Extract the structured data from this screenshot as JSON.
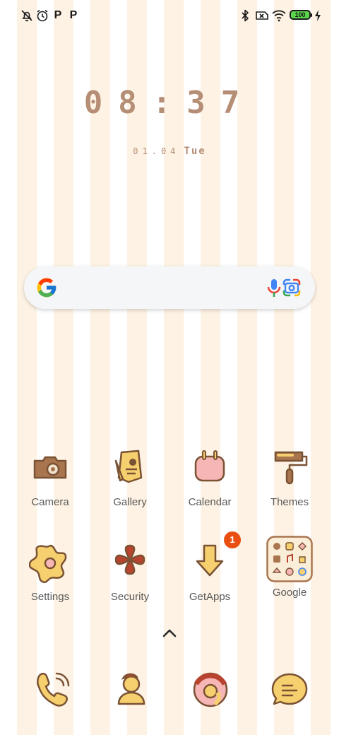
{
  "status_bar": {
    "left_icons": [
      "notifications-off-icon",
      "alarm-icon",
      "p-app-icon",
      "p-app-icon"
    ],
    "right_icons": [
      "bluetooth-icon",
      "no-sim-icon",
      "wifi-icon",
      "battery-icon",
      "charging-icon"
    ],
    "battery_level": "100"
  },
  "clock": {
    "time": "08:37",
    "date": "01.04",
    "weekday": "Tue"
  },
  "search_bar": {
    "icons": [
      "google-icon",
      "microphone-icon",
      "google-lens-icon"
    ]
  },
  "apps": [
    {
      "label": "Camera",
      "icon": "camera-icon"
    },
    {
      "label": "Gallery",
      "icon": "gallery-icon"
    },
    {
      "label": "Calendar",
      "icon": "calendar-icon"
    },
    {
      "label": "Themes",
      "icon": "themes-icon"
    },
    {
      "label": "Settings",
      "icon": "settings-icon"
    },
    {
      "label": "Security",
      "icon": "security-icon"
    },
    {
      "label": "GetApps",
      "icon": "getapps-icon",
      "badge": "1"
    },
    {
      "label": "Google",
      "icon": "google-folder-icon"
    }
  ],
  "dock": [
    {
      "icon": "phone-icon"
    },
    {
      "icon": "contacts-icon"
    },
    {
      "icon": "browser-icon"
    },
    {
      "icon": "messages-icon"
    }
  ],
  "colors": {
    "stripe": "#fdf2e3",
    "clock_text": "#b58e75",
    "icon_outline": "#7a5234",
    "icon_fill": "#f6cf6e",
    "badge": "#ea4f12",
    "label": "#5a5a5a"
  }
}
